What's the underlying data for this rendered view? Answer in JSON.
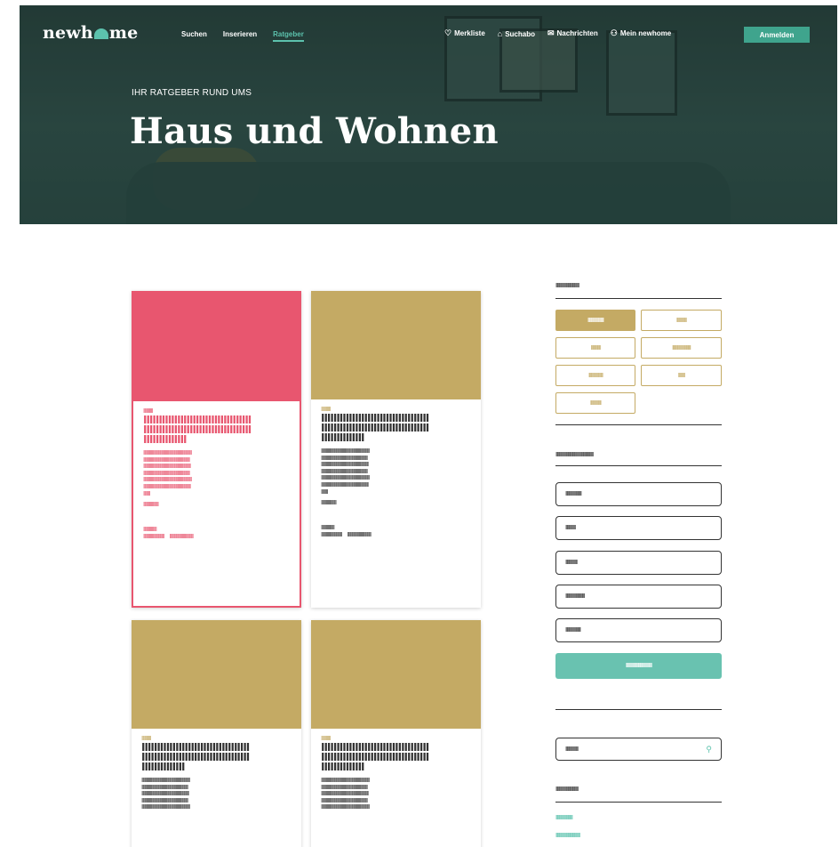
{
  "header": {
    "logo": {
      "pre": "newh",
      "post": "me"
    },
    "nav": [
      {
        "label": "Suchen"
      },
      {
        "label": "Inserieren"
      },
      {
        "label": "Ratgeber"
      }
    ],
    "utility": [
      {
        "icon": "heart-icon",
        "glyph": "♡",
        "label": "Merkliste"
      },
      {
        "icon": "bell-icon",
        "glyph": "⌂",
        "label": "Suchabo"
      },
      {
        "icon": "mail-icon",
        "glyph": "✉",
        "label": "Nachrichten"
      },
      {
        "icon": "user-icon",
        "glyph": "⚇",
        "label": "Mein newhome"
      }
    ],
    "login_label": "Anmelden"
  },
  "hero": {
    "kicker": "IHR RATGEBER RUND UMS",
    "title": "Haus und Wohnen"
  },
  "colors": {
    "accent_teal": "#5cc2ad",
    "accent_pink": "#e8566f",
    "accent_gold": "#c4aa64",
    "header_green": "#3fa48d"
  },
  "cards": [
    {
      "image_color": "#e8566f",
      "kicker": "IIIIIIIIII",
      "title": [
        "IIIIIIIIIIIIIIIIIIIIIIIIIIIIIIIIIII",
        "IIIIIIIIIIIIIIIIIIIIIIIIIIIIIIIIIII",
        "IIIIIIIIIIIIII"
      ],
      "text": [
        "IIIIIIIIIIIIIIIIIIIIIIIIIIIIIIIIIIIIIIIIIIIIIIIIIII",
        "IIIIIIIIIIIIIIIIIIIIIIIIIIIIIIIIIIIIIIIIIIIIIIIII",
        "IIIIIIIIIIIIIIIIIIIIIIIIIIIIIIIIIIIIIIIIIIIIIIIIII",
        "IIIIIIIIIIIIIIIIIIIIIIIIIIIIIIIIIIIIIIIIIIIIIIIII",
        "IIIIIIIIIIIIIIIIIIIIIIIIIIIIIIIIIIIIIIIIIIIIIIIIIII",
        "IIIIIIIIIIIIIIIIIIIIIIIIIIIIIIIIIIIIIIIIIIIIIIIIII",
        "IIIIIII"
      ],
      "more": "IIIIIIIIIIIIIIII",
      "meta1": "IIIIIIIIIIIIII",
      "meta2a": "IIIIIIIIIIIIIIIIIIIIII",
      "meta2b": "IIIIIIIIIIIIIIIIIIIIIIIII"
    },
    {
      "image_color": "#c4aa64",
      "kicker": "IIIIIIIIII",
      "title": [
        "IIIIIIIIIIIIIIIIIIIIIIIIIIIIIIIIIII",
        "IIIIIIIIIIIIIIIIIIIIIIIIIIIIIIIIIII",
        "IIIIIIIIIIIIII"
      ],
      "text": [
        "IIIIIIIIIIIIIIIIIIIIIIIIIIIIIIIIIIIIIIIIIIIIIIIIIII",
        "IIIIIIIIIIIIIIIIIIIIIIIIIIIIIIIIIIIIIIIIIIIIIIIII",
        "IIIIIIIIIIIIIIIIIIIIIIIIIIIIIIIIIIIIIIIIIIIIIIIIII",
        "IIIIIIIIIIIIIIIIIIIIIIIIIIIIIIIIIIIIIIIIIIIIIIIII",
        "IIIIIIIIIIIIIIIIIIIIIIIIIIIIIIIIIIIIIIIIIIIIIIIIIII",
        "IIIIIIIIIIIIIIIIIIIIIIIIIIIIIIIIIIIIIIIIIIIIIIIIII",
        "IIIIIII"
      ],
      "more": "IIIIIIIIIIIIIIII",
      "meta1": "IIIIIIIIIIIIII",
      "meta2a": "IIIIIIIIIIIIIIIIIIIIII",
      "meta2b": "IIIIIIIIIIIIIIIIIIIIIIIII"
    },
    {
      "image_color": "#c4aa64",
      "kicker": "IIIIIIIIII",
      "title": [
        "IIIIIIIIIIIIIIIIIIIIIIIIIIIIIIIIIII",
        "IIIIIIIIIIIIIIIIIIIIIIIIIIIIIIIIIII",
        "IIIIIIIIIIIIII"
      ],
      "text": [
        "IIIIIIIIIIIIIIIIIIIIIIIIIIIIIIIIIIIIIIIIIIIIIIIIIII",
        "IIIIIIIIIIIIIIIIIIIIIIIIIIIIIIIIIIIIIIIIIIIIIIIII",
        "IIIIIIIIIIIIIIIIIIIIIIIIIIIIIIIIIIIIIIIIIIIIIIIIII",
        "IIIIIIIIIIIIIIIIIIIIIIIIIIIIIIIIIIIIIIIIIIIIIIIII",
        "IIIIIIIIIIIIIIIIIIIIIIIIIIIIIIIIIIIIIIIIIIIIIIIIIII"
      ],
      "more": "",
      "meta1": "",
      "meta2a": "",
      "meta2b": ""
    },
    {
      "image_color": "#c4aa64",
      "kicker": "IIIIIIIIII",
      "title": [
        "IIIIIIIIIIIIIIIIIIIIIIIIIIIIIIIIIII",
        "IIIIIIIIIIIIIIIIIIIIIIIIIIIIIIIIIII",
        "IIIIIIIIIIIIII"
      ],
      "text": [
        "IIIIIIIIIIIIIIIIIIIIIIIIIIIIIIIIIIIIIIIIIIIIIIIIIII",
        "IIIIIIIIIIIIIIIIIIIIIIIIIIIIIIIIIIIIIIIIIIIIIIIII",
        "IIIIIIIIIIIIIIIIIIIIIIIIIIIIIIIIIIIIIIIIIIIIIIIIII",
        "IIIIIIIIIIIIIIIIIIIIIIIIIIIIIIIIIIIIIIIIIIIIIIIII",
        "IIIIIIIIIIIIIIIIIIIIIIIIIIIIIIIIIIIIIIIIIIIIIIIIIII"
      ],
      "more": "",
      "meta1": "",
      "meta2a": "",
      "meta2b": ""
    }
  ],
  "sidebar": {
    "categories_heading": "IIIIIIIIIIIIIIIIIIIIIIIIIIIII",
    "chips": [
      {
        "label": "IIIIIIIIIIIIIIIIIII",
        "selected": true
      },
      {
        "label": "IIIIIIIIIIII",
        "selected": false
      },
      {
        "label": "IIIIIIIIIIII",
        "selected": false
      },
      {
        "label": "IIIIIIIIIIIIIIIIIIIIII",
        "selected": false
      },
      {
        "label": "IIIIIIIIIIIIIIIII",
        "selected": false
      },
      {
        "label": "IIIIIIII",
        "selected": false
      },
      {
        "label": "IIIIIIIIIIIII",
        "selected": false
      }
    ],
    "form_heading": "IIIIIIIIIIIIIIIIIIIIIIIIIIIIIIIIIIIIIIIIIIIIII",
    "fields": [
      {
        "value": "IIIIIIIIIIIIIIIIIII"
      },
      {
        "value": "IIIIIIIIIIII"
      },
      {
        "value": "IIIIIIIIIIIIII"
      },
      {
        "value": "IIIIIIIIIIIIIIIIIIIIIII"
      },
      {
        "value": "IIIIIIIIIIIIIIIIII"
      }
    ],
    "submit_label": "IIIIIIIIIIIIIIIIIIIIIIIIIIIIIII",
    "search_value": "IIIIIIIIIIIIIII",
    "links_heading": "IIIIIIIIIIIIIIIIIIIIIIIIIIII",
    "links": [
      {
        "label": "IIIIIIIIIIIIIIIIIIII"
      },
      {
        "label": "IIIIIIIIIIIIIIIIIIIIIIIIIIIII"
      }
    ]
  }
}
